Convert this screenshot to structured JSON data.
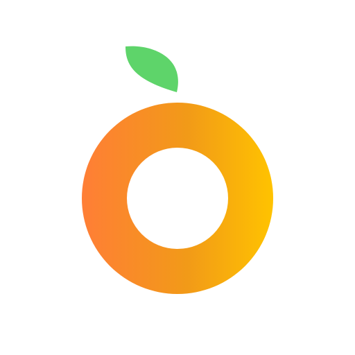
{
  "icon": {
    "name": "orange-fruit-logo",
    "colors": {
      "background": "#ffffff",
      "ring_gradient_start": "#FF7E36",
      "ring_gradient_mid": "#F29A18",
      "ring_gradient_end": "#FFC300",
      "leaf": "#5ED46A",
      "hole": "#ffffff"
    }
  }
}
